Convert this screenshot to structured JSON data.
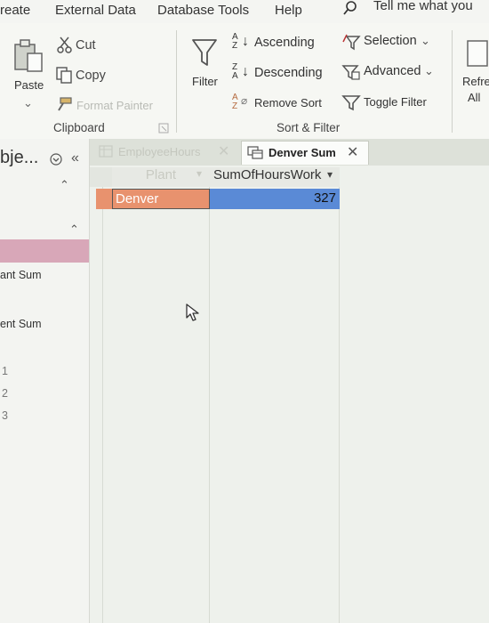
{
  "menubar": {
    "items": [
      "reate",
      "External Data",
      "Database Tools",
      "Help"
    ],
    "tell_me": "Tell me what you"
  },
  "ribbon": {
    "clipboard": {
      "paste": "Paste",
      "cut": "Cut",
      "copy": "Copy",
      "format_painter": "Format Painter",
      "label": "Clipboard"
    },
    "sort_filter": {
      "filter": "Filter",
      "ascending": "Ascending",
      "descending": "Descending",
      "remove_sort": "Remove Sort",
      "selection": "Selection",
      "advanced": "Advanced",
      "toggle_filter": "Toggle Filter",
      "label": "Sort & Filter"
    },
    "records": {
      "refresh_line1": "Refre",
      "refresh_line2": "All"
    }
  },
  "navpane": {
    "title": "bje...",
    "items": [
      "ant Sum",
      "ent Sum",
      "1",
      "2",
      "3"
    ]
  },
  "tabs": [
    {
      "label": "EmployeeHours",
      "active": false
    },
    {
      "label": "Denver Sum",
      "active": true
    }
  ],
  "datasheet": {
    "columns": [
      "Plant",
      "SumOfHoursWork"
    ],
    "rows": [
      {
        "plant": "Denver",
        "sum": "327"
      }
    ]
  },
  "colors": {
    "selected_row": "#e8926e",
    "selected_value": "#5a8ad6",
    "nav_highlight": "#d8a7b8"
  }
}
